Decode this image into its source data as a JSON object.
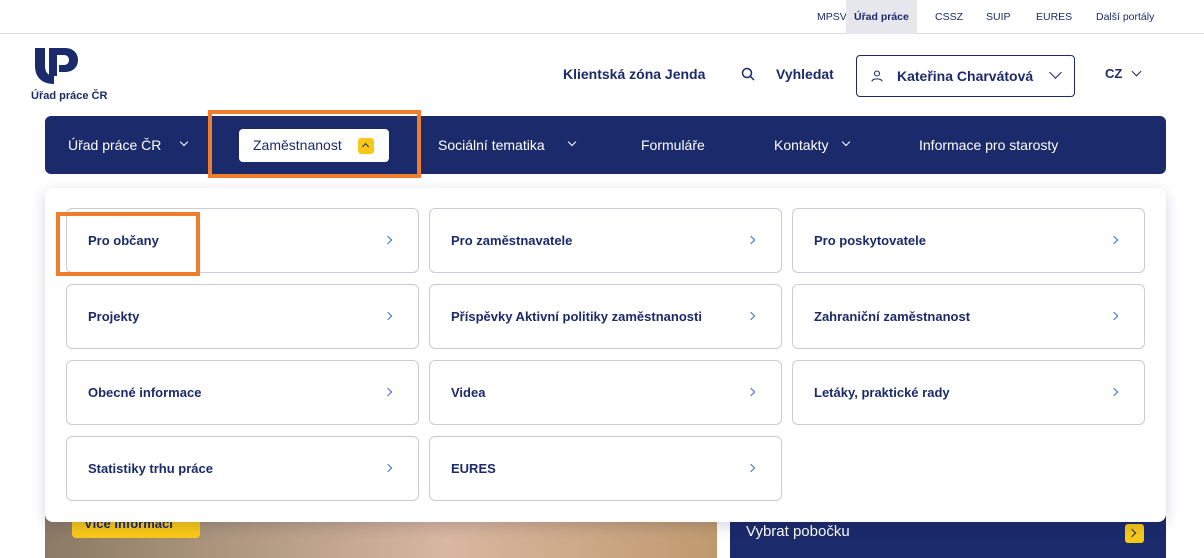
{
  "portal_bar": {
    "links": [
      "MPSV",
      "Úřad práce",
      "CSSZ",
      "SUIP",
      "EURES",
      "Další portály"
    ],
    "active": "Úřad práce"
  },
  "header": {
    "logo_text": "Úřad práce ČR",
    "client_zone": "Klientská zóna Jenda",
    "search": "Vyhledat",
    "user_name": "Kateřina Charvátová",
    "language": "CZ"
  },
  "nav": {
    "items": [
      "Úřad práce ČR",
      "Zaměstnanost",
      "Sociální tematika",
      "Formuláře",
      "Kontakty",
      "Informace pro starosty"
    ]
  },
  "dropdown": {
    "cards": [
      "Pro občany",
      "Pro zaměstnavatele",
      "Pro poskytovatele",
      "Projekty",
      "Příspěvky Aktivní politiky zaměstnanosti",
      "Zahraniční zaměstnanost",
      "Obecné informace",
      "Videa",
      "Letáky, praktické rady",
      "Statistiky trhu práce",
      "EURES"
    ]
  },
  "hero": {
    "left_button": "Více informací",
    "right_label": "Vybrat pobočku"
  },
  "colors": {
    "brand_navy": "#1b2a6b",
    "accent_yellow": "#f9c816",
    "highlight_orange": "#ee7e2c"
  }
}
